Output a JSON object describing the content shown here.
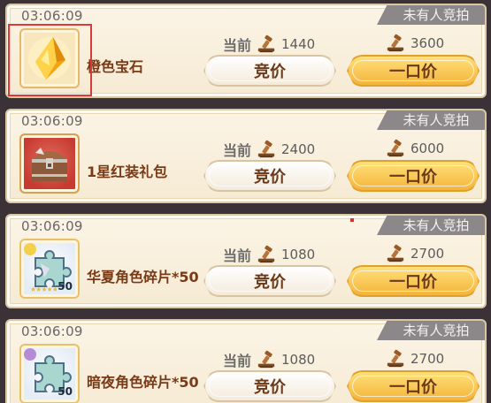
{
  "auctions": [
    {
      "timer": "03:06:09",
      "status": "未有人竞拍",
      "name": "橙色宝石",
      "current_label": "当前",
      "current_price": "1440",
      "buyout_price": "3600",
      "bid_label": "竞价",
      "buyout_label": "一口价",
      "icon": "orange-gem-icon"
    },
    {
      "timer": "03:06:09",
      "status": "未有人竞拍",
      "name": "1星红装礼包",
      "current_label": "当前",
      "current_price": "2400",
      "buyout_price": "6000",
      "bid_label": "竞价",
      "buyout_label": "一口价",
      "icon": "treasure-chest-icon"
    },
    {
      "timer": "03:06:09",
      "status": "未有人竞拍",
      "name": "华夏角色碎片*50",
      "current_label": "当前",
      "current_price": "1080",
      "buyout_price": "2700",
      "bid_label": "竞价",
      "buyout_label": "一口价",
      "icon": "puzzle-fragment-icon",
      "qty": "50"
    },
    {
      "timer": "03:06:09",
      "status": "未有人竞拍",
      "name": "暗夜角色碎片*50",
      "current_label": "当前",
      "current_price": "1080",
      "buyout_price": "2700",
      "bid_label": "竞价",
      "buyout_label": "一口价",
      "icon": "puzzle-fragment-icon",
      "qty": "50"
    }
  ],
  "colors": {
    "accent_gold": "#f4b43a",
    "item_name": "#7a3a16",
    "badge_gray": "#8c8789",
    "selection_red": "#d93a3a"
  }
}
